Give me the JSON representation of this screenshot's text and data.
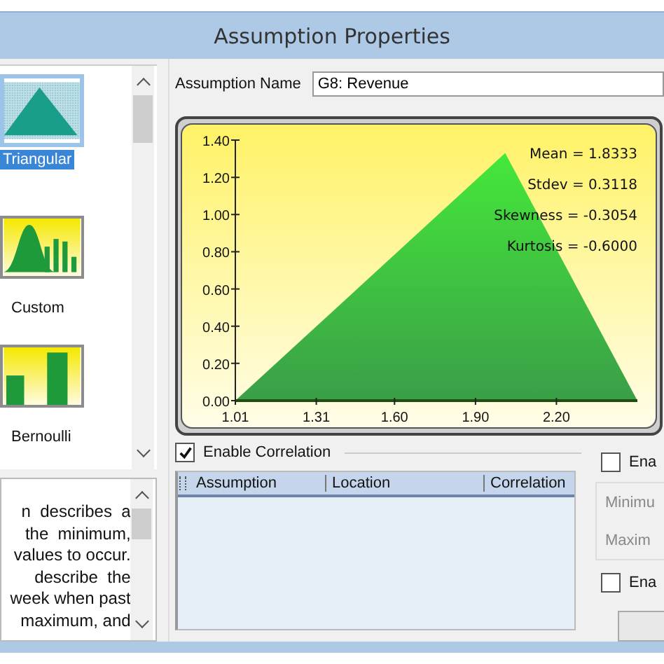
{
  "window": {
    "title": "Assumption Properties"
  },
  "gallery": {
    "items": [
      {
        "label": "Triangular",
        "kind": "triangular",
        "selected": true
      },
      {
        "label": "Custom",
        "kind": "custom",
        "selected": false
      },
      {
        "label": "Bernoulli",
        "kind": "bernoulli",
        "selected": false
      }
    ]
  },
  "description": {
    "lines": [
      "n  describes  a",
      "the  minimum,",
      "values to occur.",
      "describe  the",
      "week when past",
      "maximum, and"
    ]
  },
  "assumption_name": {
    "label": "Assumption Name",
    "value": "G8: Revenue"
  },
  "chart": {
    "statistics": [
      "Mean = 1.8333",
      "Stdev = 0.3118",
      "Skewness = -0.3054",
      "Kurtosis = -0.6000"
    ],
    "chart_data": {
      "type": "area",
      "x": [
        1.01,
        2.01,
        2.5
      ],
      "values": [
        0,
        1.33,
        0
      ],
      "xlim": [
        1.01,
        2.5
      ],
      "ylim": [
        0,
        1.4
      ],
      "xticks": [
        {
          "value": 1.01,
          "label": "1.01"
        },
        {
          "value": 1.31,
          "label": "1.31"
        },
        {
          "value": 1.6,
          "label": "1.60"
        },
        {
          "value": 1.9,
          "label": "1.90"
        },
        {
          "value": 2.2,
          "label": "2.20"
        }
      ],
      "yticks": [
        {
          "value": 0,
          "label": "0.00"
        },
        {
          "value": 0.2,
          "label": "0.20"
        },
        {
          "value": 0.4,
          "label": "0.40"
        },
        {
          "value": 0.6,
          "label": "0.60"
        },
        {
          "value": 0.8,
          "label": "0.80"
        },
        {
          "value": 1.0,
          "label": "1.00"
        },
        {
          "value": 1.2,
          "label": "1.20"
        },
        {
          "value": 1.4,
          "label": "1.40"
        }
      ]
    }
  },
  "enable_correlation": {
    "label": "Enable Correlation",
    "checked": true
  },
  "correlation_table": {
    "columns": [
      "Assumption",
      "Location",
      "Correlation"
    ]
  },
  "right_panel": {
    "checkbox_1": {
      "label": "Ena",
      "checked": false
    },
    "group_labels": [
      "Minimu",
      "Maxim"
    ],
    "checkbox_2": {
      "label": "Ena",
      "checked": false
    }
  }
}
